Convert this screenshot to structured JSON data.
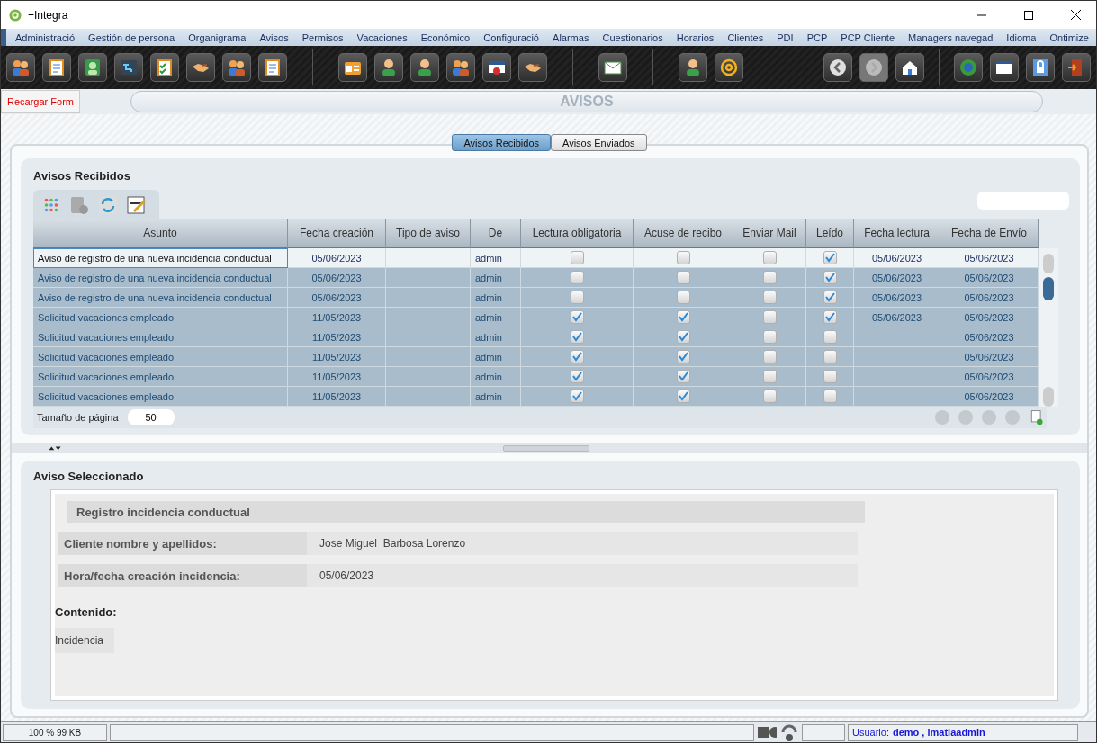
{
  "window": {
    "title": "+Integra"
  },
  "menu": [
    "Administració",
    "Gestión de persona",
    "Organigrama",
    "Avisos",
    "Permisos",
    "Vacaciones",
    "Económico",
    "Configuració",
    "Alarmas",
    "Cuestionarios",
    "Horarios",
    "Clientes",
    "PDI",
    "PCP",
    "PCP Cliente",
    "Managers navegad",
    "Idioma",
    "Ontimize"
  ],
  "toolbar": {
    "groups": [
      [
        {
          "kind": "people"
        },
        {
          "kind": "notepad"
        },
        {
          "kind": "person-card"
        },
        {
          "kind": "chart"
        },
        {
          "kind": "checklist"
        },
        {
          "kind": "handshake"
        },
        {
          "kind": "people"
        },
        {
          "kind": "notepad"
        }
      ],
      [
        {
          "kind": "id-card"
        },
        {
          "kind": "person"
        },
        {
          "kind": "person"
        },
        {
          "kind": "people"
        },
        {
          "kind": "certificate"
        },
        {
          "kind": "handshake"
        }
      ],
      [
        {
          "kind": "envelope"
        }
      ],
      [
        {
          "kind": "person"
        },
        {
          "kind": "at"
        }
      ]
    ],
    "right": [
      {
        "kind": "back",
        "disabled": false
      },
      {
        "kind": "forward",
        "disabled": true
      },
      {
        "kind": "home",
        "disabled": false
      },
      {
        "kind": "help",
        "disabled": false
      },
      {
        "kind": "window",
        "disabled": false
      },
      {
        "kind": "lock",
        "disabled": false
      },
      {
        "kind": "exit",
        "disabled": false
      }
    ]
  },
  "reload_button": "Recargar Form",
  "page_title": "AVISOS",
  "tabs": [
    {
      "label": "Avisos Recibidos",
      "selected": true
    },
    {
      "label": "Avisos Enviados",
      "selected": false
    }
  ],
  "list": {
    "title": "Avisos Recibidos",
    "columns": [
      "Asunto",
      "Fecha creación",
      "Tipo de aviso",
      "De",
      "Lectura obligatoria",
      "Acuse de recibo",
      "Enviar Mail",
      "Leído",
      "Fecha lectura",
      "Fecha de Envío"
    ],
    "rows": [
      {
        "asunto": "Aviso de registro de una nueva incidencia conductual",
        "fecha_creacion": "05/06/2023",
        "de": "admin",
        "lectura_obligatoria": false,
        "acuse_recibo": false,
        "enviar_mail": false,
        "leido": true,
        "fecha_lectura": "05/06/2023",
        "fecha_envio": "05/06/2023",
        "selected": true
      },
      {
        "asunto": "Aviso de registro de una nueva incidencia conductual",
        "fecha_creacion": "05/06/2023",
        "de": "admin",
        "lectura_obligatoria": false,
        "acuse_recibo": false,
        "enviar_mail": false,
        "leido": true,
        "fecha_lectura": "05/06/2023",
        "fecha_envio": "05/06/2023",
        "selected": false
      },
      {
        "asunto": "Aviso de registro de una nueva incidencia conductual",
        "fecha_creacion": "05/06/2023",
        "de": "admin",
        "lectura_obligatoria": false,
        "acuse_recibo": false,
        "enviar_mail": false,
        "leido": true,
        "fecha_lectura": "05/06/2023",
        "fecha_envio": "05/06/2023",
        "selected": false
      },
      {
        "asunto": "Solicitud vacaciones empleado",
        "fecha_creacion": "11/05/2023",
        "de": "admin",
        "lectura_obligatoria": true,
        "acuse_recibo": true,
        "enviar_mail": false,
        "leido": true,
        "fecha_lectura": "05/06/2023",
        "fecha_envio": "05/06/2023",
        "selected": false
      },
      {
        "asunto": "Solicitud vacaciones empleado",
        "fecha_creacion": "11/05/2023",
        "de": "admin",
        "lectura_obligatoria": true,
        "acuse_recibo": true,
        "enviar_mail": false,
        "leido": false,
        "fecha_envio": "05/06/2023",
        "selected": false
      },
      {
        "asunto": "Solicitud vacaciones empleado",
        "fecha_creacion": "11/05/2023",
        "de": "admin",
        "lectura_obligatoria": true,
        "acuse_recibo": true,
        "enviar_mail": false,
        "leido": false,
        "fecha_envio": "05/06/2023",
        "selected": false
      },
      {
        "asunto": "Solicitud vacaciones empleado",
        "fecha_creacion": "11/05/2023",
        "de": "admin",
        "lectura_obligatoria": true,
        "acuse_recibo": true,
        "enviar_mail": false,
        "leido": false,
        "fecha_envio": "05/06/2023",
        "selected": false
      },
      {
        "asunto": "Solicitud vacaciones empleado",
        "fecha_creacion": "11/05/2023",
        "de": "admin",
        "lectura_obligatoria": true,
        "acuse_recibo": true,
        "enviar_mail": false,
        "leido": false,
        "fecha_envio": "05/06/2023",
        "selected": false
      }
    ],
    "page_size_label": "Tamaño de página",
    "page_size": "50"
  },
  "detail": {
    "title": "Aviso Seleccionado",
    "heading": "Registro incidencia conductual",
    "fields": [
      {
        "label": "Cliente nombre y apellidos:",
        "value": "Jose Miguel  Barbosa Lorenzo"
      },
      {
        "label": "Hora/fecha creación incidencia:",
        "value": "05/06/2023"
      }
    ],
    "content_label": "Contenido:",
    "content": "Incidencia"
  },
  "status_bar": {
    "memory": "100 %  99 KB",
    "user_label": "Usuario:",
    "user": "demo , imatiaadmin"
  }
}
